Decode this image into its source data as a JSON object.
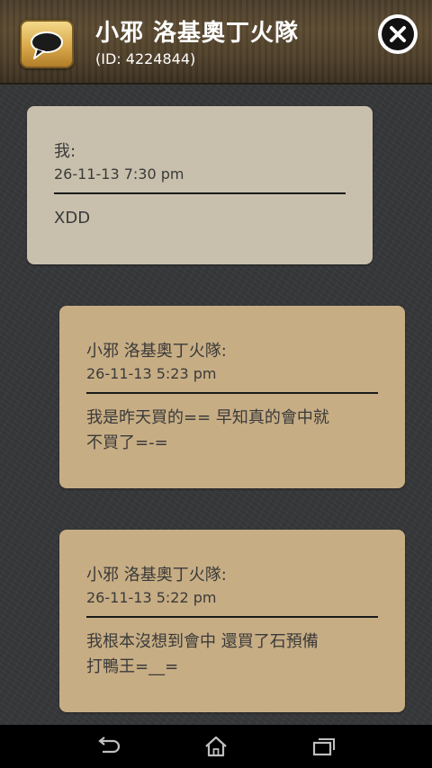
{
  "header": {
    "title": "小邪 洛基奧丁火隊",
    "subtitle": "(ID: 4224844)",
    "app_icon": "chat-bubble-icon",
    "close_icon": "close-icon"
  },
  "messages": [
    {
      "sender": "我:",
      "time": "26-11-13 7:30 pm",
      "text": [
        "XDD"
      ],
      "kind": "mine"
    },
    {
      "sender": "小邪 洛基奧丁火隊:",
      "time": "26-11-13 5:23 pm",
      "text": [
        "我是昨天買的== 早知真的會中就",
        "不買了=-="
      ],
      "kind": "theirs"
    },
    {
      "sender": "小邪 洛基奧丁火隊:",
      "time": "26-11-13 5:22 pm",
      "text": [
        "我根本沒想到會中 還買了石預備",
        "打鴨王=__="
      ],
      "kind": "theirs"
    }
  ],
  "navbar": {
    "back_icon": "back-icon",
    "home_icon": "home-icon",
    "recents_icon": "recent-apps-icon"
  },
  "colors": {
    "mine_bubble": "#c8c0ad",
    "their_bubble": "#c7ad84",
    "header": "#4e3f29",
    "background": "#37383a"
  }
}
